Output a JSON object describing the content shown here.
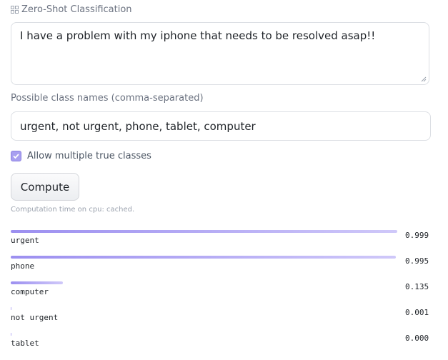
{
  "widget": {
    "title": "Zero-Shot Classification",
    "icon": "grid-icon"
  },
  "input_text": "I have a problem with my iphone that needs to be resolved asap!!",
  "class_names": {
    "label": "Possible class names (comma-separated)",
    "value": "urgent, not urgent, phone, tablet, computer"
  },
  "multi_label": {
    "label": "Allow multiple true classes",
    "checked": true
  },
  "compute": {
    "button_label": "Compute",
    "status": "Computation time on cpu: cached."
  },
  "results": [
    {
      "label": "urgent",
      "score_text": "0.999",
      "score": 0.999
    },
    {
      "label": "phone",
      "score_text": "0.995",
      "score": 0.995
    },
    {
      "label": "computer",
      "score_text": "0.135",
      "score": 0.135
    },
    {
      "label": "not urgent",
      "score_text": "0.001",
      "score": 0.001
    },
    {
      "label": "tablet",
      "score_text": "0.000",
      "score": 0.0
    }
  ],
  "colors": {
    "accent": "#9c8ff0",
    "checkbox": "#a89ff0"
  }
}
